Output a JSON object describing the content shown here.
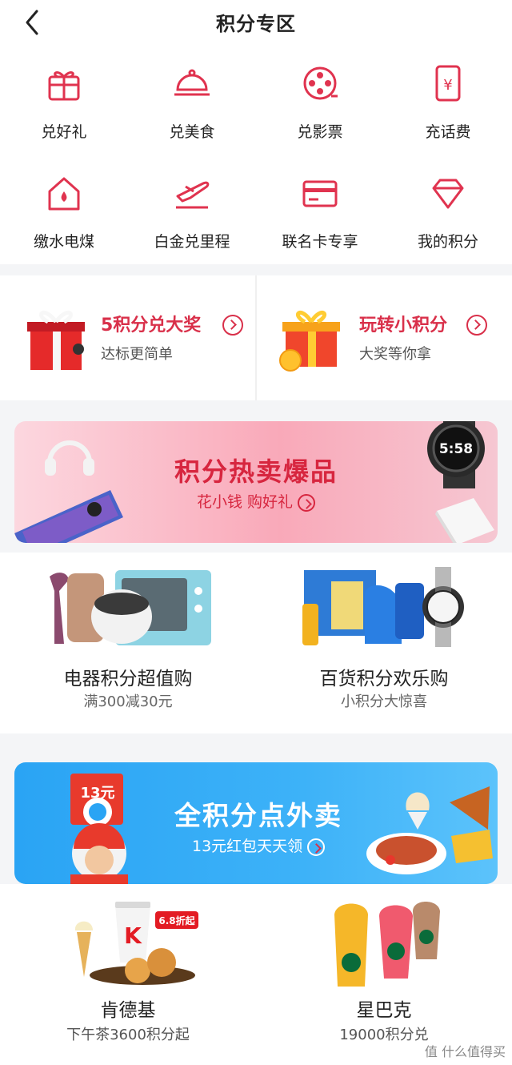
{
  "header": {
    "title": "积分专区"
  },
  "grid": {
    "items": [
      {
        "label": "兑好礼",
        "icon": "gift-icon"
      },
      {
        "label": "兑美食",
        "icon": "food-cloche-icon"
      },
      {
        "label": "兑影票",
        "icon": "film-reel-icon"
      },
      {
        "label": "充话费",
        "icon": "phone-yuan-icon"
      },
      {
        "label": "缴水电煤",
        "icon": "home-drop-icon"
      },
      {
        "label": "白金兑里程",
        "icon": "airplane-icon"
      },
      {
        "label": "联名卡专享",
        "icon": "card-icon"
      },
      {
        "label": "我的积分",
        "icon": "diamond-icon"
      }
    ]
  },
  "promos": [
    {
      "title": "5积分兑大奖",
      "sub": "达标更简单"
    },
    {
      "title": "玩转小积分",
      "sub": "大奖等你拿"
    }
  ],
  "banner1": {
    "title": "积分热卖爆品",
    "sub": "花小钱 购好礼",
    "watch_time": "5:58"
  },
  "tiles": [
    {
      "title": "电器积分超值购",
      "sub": "满300减30元"
    },
    {
      "title": "百货积分欢乐购",
      "sub": "小积分大惊喜"
    }
  ],
  "banner2": {
    "title": "全积分点外卖",
    "sub": "13元红包天天领",
    "coupon": "13元"
  },
  "food": [
    {
      "title": "肯德基",
      "sub": "下午茶3600积分起",
      "badge": "6.8折起",
      "logo": "K"
    },
    {
      "title": "星巴克",
      "sub": "19000积分兑"
    }
  ],
  "watermark": "值 什么值得买",
  "colors": {
    "accent": "#d9304a",
    "blue": "#2aa4f4",
    "pink": "#f9a9b9"
  }
}
